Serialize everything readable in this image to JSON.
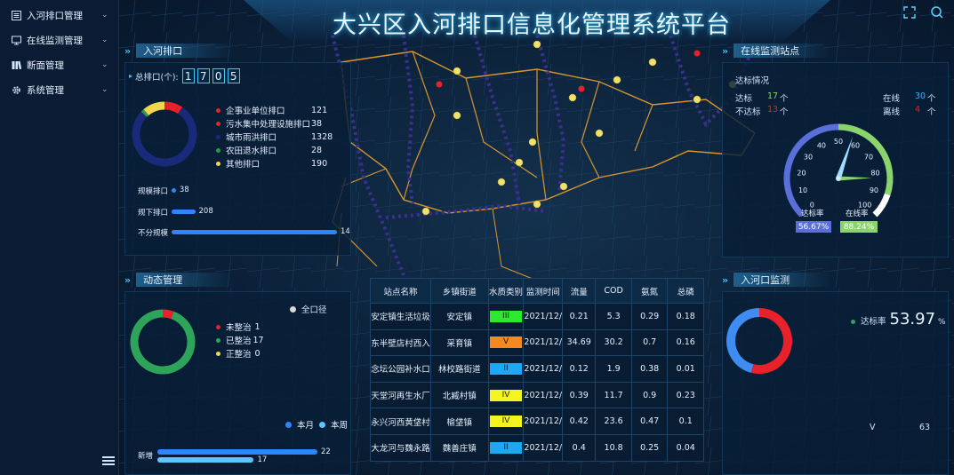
{
  "sidebar": {
    "items": [
      {
        "label": "入河排口管理",
        "icon": "list-icon"
      },
      {
        "label": "在线监测管理",
        "icon": "monitor-icon"
      },
      {
        "label": "断面管理",
        "icon": "book-icon"
      },
      {
        "label": "系统管理",
        "icon": "gear-icon"
      }
    ]
  },
  "header": {
    "title": "大兴区入河排口信息化管理系统平台"
  },
  "outlets": {
    "heading": "入河排口",
    "total_label": "总排口(个):",
    "total_digits": [
      "1",
      "7",
      "0",
      "5"
    ],
    "legend": [
      {
        "label": "企事业单位排口",
        "value": "121",
        "color": "#e8212a"
      },
      {
        "label": "污水集中处理设施排口",
        "value": "38",
        "color": "#e8212a"
      },
      {
        "label": "城市雨洪排口",
        "value": "1328",
        "color": "#1a2a7a"
      },
      {
        "label": "农田退水排口",
        "value": "28",
        "color": "#2e9a47"
      },
      {
        "label": "其他排口",
        "value": "190",
        "color": "#f2d64b"
      }
    ],
    "scale_bars": [
      {
        "label": "规模排口",
        "value": "38",
        "amount": 38
      },
      {
        "label": "规下排口",
        "value": "208",
        "amount": 208
      },
      {
        "label": "不分规模",
        "value": "14",
        "amount": 1459
      }
    ]
  },
  "stations": {
    "heading": "在线监测站点",
    "status_title": "达标情况",
    "reach_label": "达标",
    "reach_value": "17",
    "unreach_label": "不达标",
    "unreach_value": "13",
    "online_label": "在线",
    "online_value": "30",
    "offline_label": "离线",
    "offline_value": "4",
    "unit": "个",
    "gauge_ticks": [
      "0",
      "10",
      "20",
      "30",
      "40",
      "50",
      "60",
      "70",
      "80",
      "90",
      "100"
    ],
    "gauge_needle": 57,
    "rate_label": "达标率",
    "rate_value": "56.67%",
    "online_rate_label": "在线率",
    "online_rate_value": "88.24%",
    "colors": {
      "rate": "#5a6fd8",
      "online": "#8bd46c"
    }
  },
  "dynamic": {
    "heading": "动态管理",
    "mode_label": "全口径",
    "legend": [
      {
        "label": "未整治",
        "value": "1",
        "color": "#e8212a"
      },
      {
        "label": "已整治",
        "value": "17",
        "color": "#2ea45a"
      },
      {
        "label": "正整治",
        "value": "0",
        "color": "#f2d64b"
      }
    ],
    "period_month": "本月",
    "period_week": "本周",
    "bar_label": "新增",
    "bar_month": 22,
    "bar_week": 17,
    "bar_month_text": "22",
    "bar_week_text": "17"
  },
  "monitor_table": {
    "headers": [
      "站点名称",
      "乡镇街道",
      "水质类别",
      "监测时间",
      "流量",
      "COD",
      "氨氮",
      "总磷"
    ],
    "rows": [
      {
        "name": "安定镇生活垃圾",
        "town": "安定镇",
        "class": "III",
        "class_color": "#2ee82e",
        "time": "2021/12/",
        "flow": "0.21",
        "cod": "5.3",
        "nh": "0.29",
        "tp": "0.18"
      },
      {
        "name": "东半壁店村西入",
        "town": "采育镇",
        "class": "V",
        "class_color": "#f5881e",
        "time": "2021/12/",
        "flow": "34.69",
        "cod": "30.2",
        "nh": "0.7",
        "tp": "0.16"
      },
      {
        "name": "念坛公园补水口",
        "town": "林校路街道",
        "class": "II",
        "class_color": "#1ea7f2",
        "time": "2021/12/",
        "flow": "0.12",
        "cod": "1.9",
        "nh": "0.38",
        "tp": "0.01"
      },
      {
        "name": "天堂河再生水厂",
        "town": "北臧村镇",
        "class": "IV",
        "class_color": "#f4f41e",
        "time": "2021/12/",
        "flow": "0.39",
        "cod": "11.7",
        "nh": "0.9",
        "tp": "0.23"
      },
      {
        "name": "永兴河西黄垡村",
        "town": "榆垡镇",
        "class": "IV",
        "class_color": "#f4f41e",
        "time": "2021/12/",
        "flow": "0.42",
        "cod": "23.6",
        "nh": "0.47",
        "tp": "0.1"
      },
      {
        "name": "大龙河与魏永路",
        "town": "魏善庄镇",
        "class": "II",
        "class_color": "#1ea7f2",
        "time": "2021/12/",
        "flow": "0.4",
        "cod": "10.8",
        "nh": "0.25",
        "tp": "0.04"
      }
    ]
  },
  "inlet": {
    "heading": "入河口监测",
    "rate_label": "达标率",
    "rate_value": "53.97",
    "rate_unit": "%",
    "rate_fraction": 0.5397,
    "class_label": "V",
    "class_count": "63"
  }
}
